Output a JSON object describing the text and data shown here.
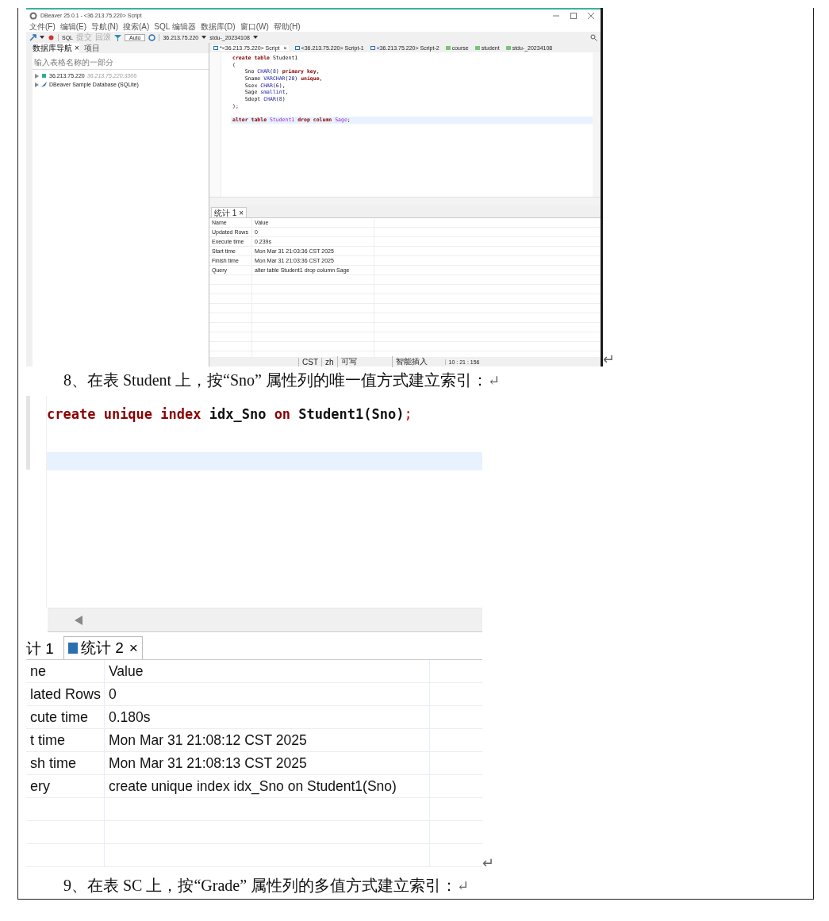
{
  "screenshot_1": {
    "window": {
      "title": "DBeaver 25.0.1 - <36.213.75.220> Script"
    },
    "menu": [
      "文件(F)",
      "编辑(E)",
      "导航(N)",
      "搜索(A)",
      "SQL 编辑器",
      "数据库(D)",
      "窗口(W)",
      "帮助(H)"
    ],
    "toolbar": {
      "sql": "SQL",
      "commit": {
        "label": "提交",
        "disabled": true
      },
      "rollback": {
        "label": "回滚",
        "disabled": true
      },
      "mode": "Auto",
      "connection": "36.213.75.220",
      "database": "stdu-_20234108"
    },
    "navigator": {
      "tabs": [
        {
          "label": "数据库导航",
          "selected": true,
          "close": "×"
        },
        {
          "label": "项目",
          "selected": false
        }
      ],
      "filter": {
        "placeholder": "输入表格名称的一部分"
      },
      "tree": [
        {
          "label": "36.213.75.220",
          "detail": "36.213.75.220:3306",
          "kind": "mysql"
        },
        {
          "label": "DBeaver Sample Database (SQLite)",
          "kind": "sqlite"
        }
      ]
    },
    "editor_tabs": [
      {
        "label": "*<36.213.75.220> Script",
        "selected": true,
        "close": "×",
        "kind": "script"
      },
      {
        "label": "<36.213.75.220> Script-1",
        "selected": false,
        "kind": "script"
      },
      {
        "label": "<36.213.75.220> Script-2",
        "selected": false,
        "kind": "script"
      },
      {
        "label": "course",
        "selected": false,
        "kind": "table"
      },
      {
        "label": "student",
        "selected": false,
        "kind": "table"
      },
      {
        "label": "stdu-_20234108",
        "selected": false,
        "kind": "table"
      }
    ],
    "code": [
      {
        "highlighted": false,
        "tokens": [
          {
            "t": "create ",
            "kind": "kw"
          },
          {
            "t": "table",
            "kind": "kw"
          },
          {
            "t": " Student1",
            "kind": "plain"
          }
        ]
      },
      {
        "highlighted": false,
        "tokens": [
          {
            "t": "(",
            "kind": "plain"
          }
        ]
      },
      {
        "highlighted": false,
        "tokens": [
          {
            "t": "    Sno ",
            "kind": "plain"
          },
          {
            "t": "CHAR",
            "kind": "type"
          },
          {
            "t": "(",
            "kind": "plain"
          },
          {
            "t": "8",
            "kind": "num"
          },
          {
            "t": ") ",
            "kind": "plain"
          },
          {
            "t": "primary key",
            "kind": "kw"
          },
          {
            "t": ",",
            "kind": "plain"
          }
        ]
      },
      {
        "highlighted": false,
        "tokens": [
          {
            "t": "    Sname ",
            "kind": "plain"
          },
          {
            "t": "VARCHAR",
            "kind": "type"
          },
          {
            "t": "(",
            "kind": "plain"
          },
          {
            "t": "20",
            "kind": "num"
          },
          {
            "t": ") ",
            "kind": "plain"
          },
          {
            "t": "unique",
            "kind": "kw"
          },
          {
            "t": ",",
            "kind": "plain"
          }
        ]
      },
      {
        "highlighted": false,
        "tokens": [
          {
            "t": "    Ssex ",
            "kind": "plain"
          },
          {
            "t": "CHAR",
            "kind": "type"
          },
          {
            "t": "(",
            "kind": "plain"
          },
          {
            "t": "6",
            "kind": "num"
          },
          {
            "t": "),",
            "kind": "plain"
          }
        ]
      },
      {
        "highlighted": false,
        "tokens": [
          {
            "t": "    Sage ",
            "kind": "plain"
          },
          {
            "t": "smallint",
            "kind": "type"
          },
          {
            "t": ",",
            "kind": "plain"
          }
        ]
      },
      {
        "highlighted": false,
        "tokens": [
          {
            "t": "    Sdept ",
            "kind": "plain"
          },
          {
            "t": "CHAR",
            "kind": "type"
          },
          {
            "t": "(",
            "kind": "plain"
          },
          {
            "t": "8",
            "kind": "num"
          },
          {
            "t": ")",
            "kind": "plain"
          }
        ]
      },
      {
        "highlighted": false,
        "tokens": [
          {
            "t": ")",
            "kind": "plain"
          },
          {
            "t": ";",
            "kind": "end"
          }
        ]
      },
      {
        "highlighted": true,
        "tokens": [
          {
            "t": "alter ",
            "kind": "kw"
          },
          {
            "t": "table ",
            "kind": "kw"
          },
          {
            "t": "Student1 ",
            "kind": "name"
          },
          {
            "t": "drop ",
            "kind": "kw"
          },
          {
            "t": "column ",
            "kind": "kw"
          },
          {
            "t": "Sage",
            "kind": "name"
          },
          {
            "t": ";",
            "kind": "plain"
          }
        ]
      }
    ],
    "result_tabs": [
      {
        "label": "统计 1",
        "selected": true,
        "close": "×"
      }
    ],
    "result_rows": [
      [
        "Name",
        "Value"
      ],
      [
        "Updated Rows",
        "0"
      ],
      [
        "Execute time",
        "0.239s"
      ],
      [
        "Start time",
        "Mon Mar 31 21:03:36 CST 2025"
      ],
      [
        "Finish time",
        "Mon Mar 31 21:03:36 CST 2025"
      ],
      [
        "Query",
        "alter table Student1 drop column Sage"
      ]
    ],
    "status": [
      "CST",
      "zh",
      "可写",
      "智能插入",
      "10 : 21 : 156"
    ]
  },
  "mark_1": "↵",
  "paragraph_8": {
    "text": "8、在表 Student 上，按“Sno” 属性列的唯一值方式建立索引：",
    "mark": "↵"
  },
  "screenshot_2": {
    "code": [
      {
        "tokens": [
          {
            "t": "create ",
            "kind": "kw"
          },
          {
            "t": "unique ",
            "kind": "kw"
          },
          {
            "t": "index",
            "kind": "kw"
          },
          {
            "t": " idx_Sno ",
            "kind": "plain"
          },
          {
            "t": "on",
            "kind": "kw"
          },
          {
            "t": " Student1(Sno)",
            "kind": "plain"
          },
          {
            "t": ";",
            "kind": "end"
          }
        ]
      }
    ],
    "result_tabs": [
      {
        "label": "计 1",
        "selected": false
      },
      {
        "label": "统计 2",
        "selected": true,
        "close": "×"
      }
    ],
    "result_rows": [
      [
        "ne",
        "Value"
      ],
      [
        "lated Rows",
        "0"
      ],
      [
        "cute time",
        "0.180s"
      ],
      [
        "t time",
        "Mon Mar 31 21:08:12 CST 2025"
      ],
      [
        "sh time",
        "Mon Mar 31 21:08:13 CST 2025"
      ],
      [
        "ery",
        "create unique index idx_Sno on Student1(Sno)"
      ]
    ]
  },
  "mark_2": "↵",
  "paragraph_9": {
    "text": "9、在表 SC 上，按“Grade” 属性列的多值方式建立索引：",
    "mark": "↵"
  }
}
